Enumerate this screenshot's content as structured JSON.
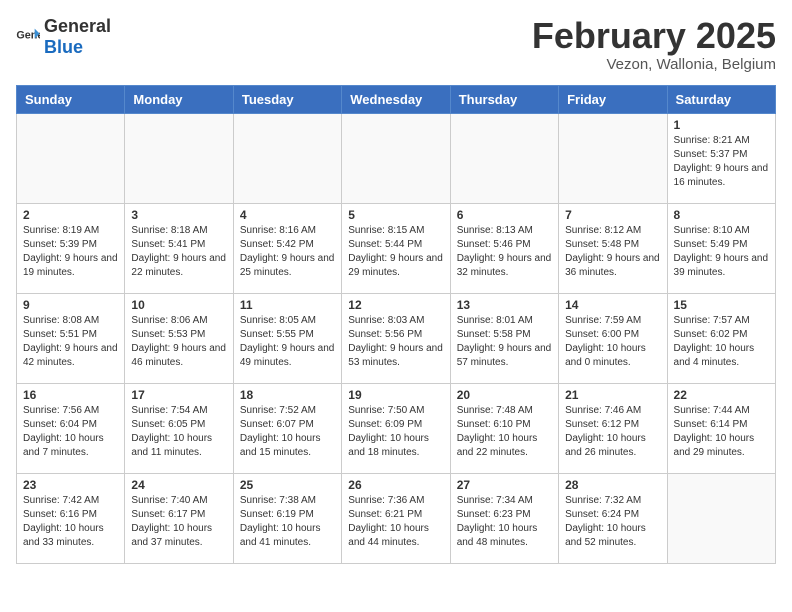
{
  "header": {
    "logo_general": "General",
    "logo_blue": "Blue",
    "title": "February 2025",
    "subtitle": "Vezon, Wallonia, Belgium"
  },
  "days_of_week": [
    "Sunday",
    "Monday",
    "Tuesday",
    "Wednesday",
    "Thursday",
    "Friday",
    "Saturday"
  ],
  "weeks": [
    [
      {
        "day": "",
        "info": ""
      },
      {
        "day": "",
        "info": ""
      },
      {
        "day": "",
        "info": ""
      },
      {
        "day": "",
        "info": ""
      },
      {
        "day": "",
        "info": ""
      },
      {
        "day": "",
        "info": ""
      },
      {
        "day": "1",
        "info": "Sunrise: 8:21 AM\nSunset: 5:37 PM\nDaylight: 9 hours and 16 minutes."
      }
    ],
    [
      {
        "day": "2",
        "info": "Sunrise: 8:19 AM\nSunset: 5:39 PM\nDaylight: 9 hours and 19 minutes."
      },
      {
        "day": "3",
        "info": "Sunrise: 8:18 AM\nSunset: 5:41 PM\nDaylight: 9 hours and 22 minutes."
      },
      {
        "day": "4",
        "info": "Sunrise: 8:16 AM\nSunset: 5:42 PM\nDaylight: 9 hours and 25 minutes."
      },
      {
        "day": "5",
        "info": "Sunrise: 8:15 AM\nSunset: 5:44 PM\nDaylight: 9 hours and 29 minutes."
      },
      {
        "day": "6",
        "info": "Sunrise: 8:13 AM\nSunset: 5:46 PM\nDaylight: 9 hours and 32 minutes."
      },
      {
        "day": "7",
        "info": "Sunrise: 8:12 AM\nSunset: 5:48 PM\nDaylight: 9 hours and 36 minutes."
      },
      {
        "day": "8",
        "info": "Sunrise: 8:10 AM\nSunset: 5:49 PM\nDaylight: 9 hours and 39 minutes."
      }
    ],
    [
      {
        "day": "9",
        "info": "Sunrise: 8:08 AM\nSunset: 5:51 PM\nDaylight: 9 hours and 42 minutes."
      },
      {
        "day": "10",
        "info": "Sunrise: 8:06 AM\nSunset: 5:53 PM\nDaylight: 9 hours and 46 minutes."
      },
      {
        "day": "11",
        "info": "Sunrise: 8:05 AM\nSunset: 5:55 PM\nDaylight: 9 hours and 49 minutes."
      },
      {
        "day": "12",
        "info": "Sunrise: 8:03 AM\nSunset: 5:56 PM\nDaylight: 9 hours and 53 minutes."
      },
      {
        "day": "13",
        "info": "Sunrise: 8:01 AM\nSunset: 5:58 PM\nDaylight: 9 hours and 57 minutes."
      },
      {
        "day": "14",
        "info": "Sunrise: 7:59 AM\nSunset: 6:00 PM\nDaylight: 10 hours and 0 minutes."
      },
      {
        "day": "15",
        "info": "Sunrise: 7:57 AM\nSunset: 6:02 PM\nDaylight: 10 hours and 4 minutes."
      }
    ],
    [
      {
        "day": "16",
        "info": "Sunrise: 7:56 AM\nSunset: 6:04 PM\nDaylight: 10 hours and 7 minutes."
      },
      {
        "day": "17",
        "info": "Sunrise: 7:54 AM\nSunset: 6:05 PM\nDaylight: 10 hours and 11 minutes."
      },
      {
        "day": "18",
        "info": "Sunrise: 7:52 AM\nSunset: 6:07 PM\nDaylight: 10 hours and 15 minutes."
      },
      {
        "day": "19",
        "info": "Sunrise: 7:50 AM\nSunset: 6:09 PM\nDaylight: 10 hours and 18 minutes."
      },
      {
        "day": "20",
        "info": "Sunrise: 7:48 AM\nSunset: 6:10 PM\nDaylight: 10 hours and 22 minutes."
      },
      {
        "day": "21",
        "info": "Sunrise: 7:46 AM\nSunset: 6:12 PM\nDaylight: 10 hours and 26 minutes."
      },
      {
        "day": "22",
        "info": "Sunrise: 7:44 AM\nSunset: 6:14 PM\nDaylight: 10 hours and 29 minutes."
      }
    ],
    [
      {
        "day": "23",
        "info": "Sunrise: 7:42 AM\nSunset: 6:16 PM\nDaylight: 10 hours and 33 minutes."
      },
      {
        "day": "24",
        "info": "Sunrise: 7:40 AM\nSunset: 6:17 PM\nDaylight: 10 hours and 37 minutes."
      },
      {
        "day": "25",
        "info": "Sunrise: 7:38 AM\nSunset: 6:19 PM\nDaylight: 10 hours and 41 minutes."
      },
      {
        "day": "26",
        "info": "Sunrise: 7:36 AM\nSunset: 6:21 PM\nDaylight: 10 hours and 44 minutes."
      },
      {
        "day": "27",
        "info": "Sunrise: 7:34 AM\nSunset: 6:23 PM\nDaylight: 10 hours and 48 minutes."
      },
      {
        "day": "28",
        "info": "Sunrise: 7:32 AM\nSunset: 6:24 PM\nDaylight: 10 hours and 52 minutes."
      },
      {
        "day": "",
        "info": ""
      }
    ]
  ]
}
